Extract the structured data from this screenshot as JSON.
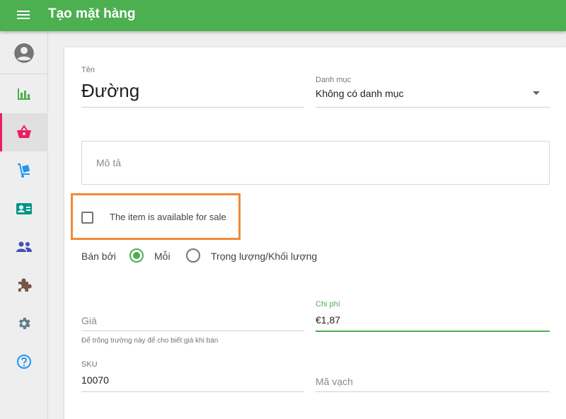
{
  "header": {
    "title": "Tạo mặt hàng"
  },
  "sidebar": {
    "items": [
      {
        "icon": "account-circle-icon"
      },
      {
        "icon": "bar-chart-icon",
        "color": "#4caf50"
      },
      {
        "icon": "basket-icon",
        "color": "#e91e63",
        "active": true
      },
      {
        "icon": "dolly-icon",
        "color": "#2196f3"
      },
      {
        "icon": "id-card-icon",
        "color": "#009688"
      },
      {
        "icon": "people-icon",
        "color": "#3f51b5"
      },
      {
        "icon": "puzzle-icon",
        "color": "#795548"
      },
      {
        "icon": "gear-icon",
        "color": "#607d8b"
      },
      {
        "icon": "help-icon",
        "color": "#2196f3"
      }
    ]
  },
  "form": {
    "name": {
      "label": "Tên",
      "value": "Đường"
    },
    "category": {
      "label": "Danh mục",
      "value": "Không có danh mục"
    },
    "description": {
      "placeholder": "Mô tả"
    },
    "available_for_sale": {
      "label": "The item is available for sale",
      "checked": false
    },
    "sold_by": {
      "label": "Bán bởi",
      "options": [
        "Mỗi",
        "Trọng lượng/Khối lượng"
      ],
      "selected": "Mỗi"
    },
    "price": {
      "placeholder": "Giá",
      "hint": "Để trống trường này để cho biết giá khi bán"
    },
    "cost": {
      "label": "Chi phí",
      "value": "€1,87"
    },
    "sku": {
      "label": "SKU",
      "value": "10070"
    },
    "barcode": {
      "placeholder": "Mã vạch"
    }
  },
  "colors": {
    "primary": "#4caf50",
    "highlight": "#f08a3c",
    "active_nav": "#e91e63"
  }
}
